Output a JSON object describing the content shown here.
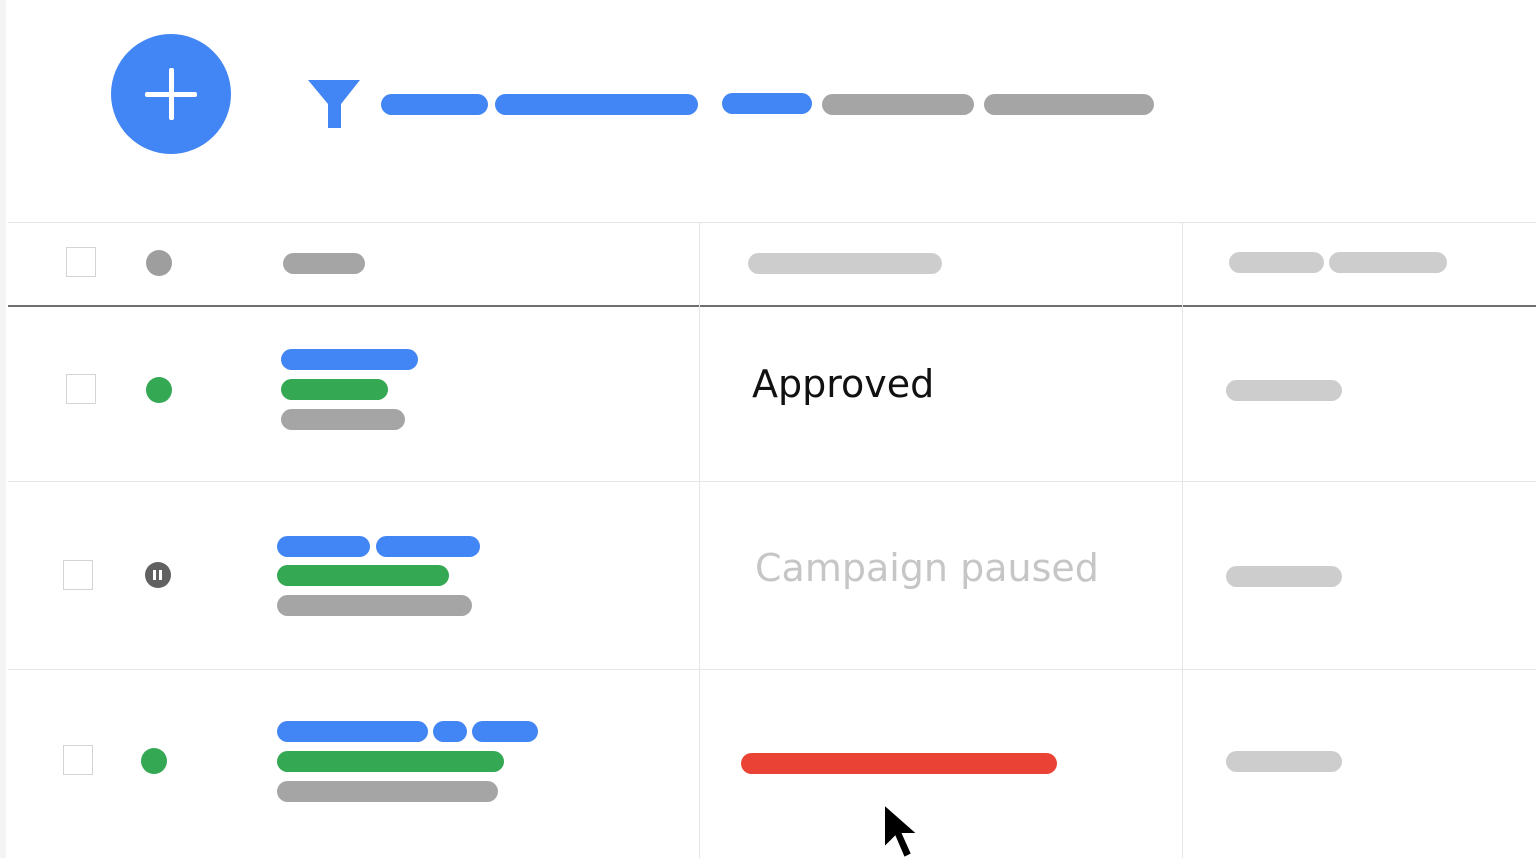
{
  "toolbar": {
    "add_button": "add-button",
    "filter_icon": "filter-icon",
    "filter_chips": [
      {
        "color": "#4285f4"
      },
      {
        "color": "#4285f4"
      },
      {
        "color": "#4285f4"
      },
      {
        "color": "#a5a5a5"
      },
      {
        "color": "#a5a5a5"
      }
    ]
  },
  "table": {
    "rows": [
      {
        "status_dot": "green",
        "status_text": "Approved"
      },
      {
        "status_dot": "paused-icon",
        "status_text": "Campaign paused"
      },
      {
        "status_dot": "green",
        "status_text": ""
      }
    ]
  },
  "colors": {
    "accent_blue": "#4285f4",
    "green": "#34a853",
    "red": "#ea4335",
    "gray": "#a5a5a5"
  }
}
